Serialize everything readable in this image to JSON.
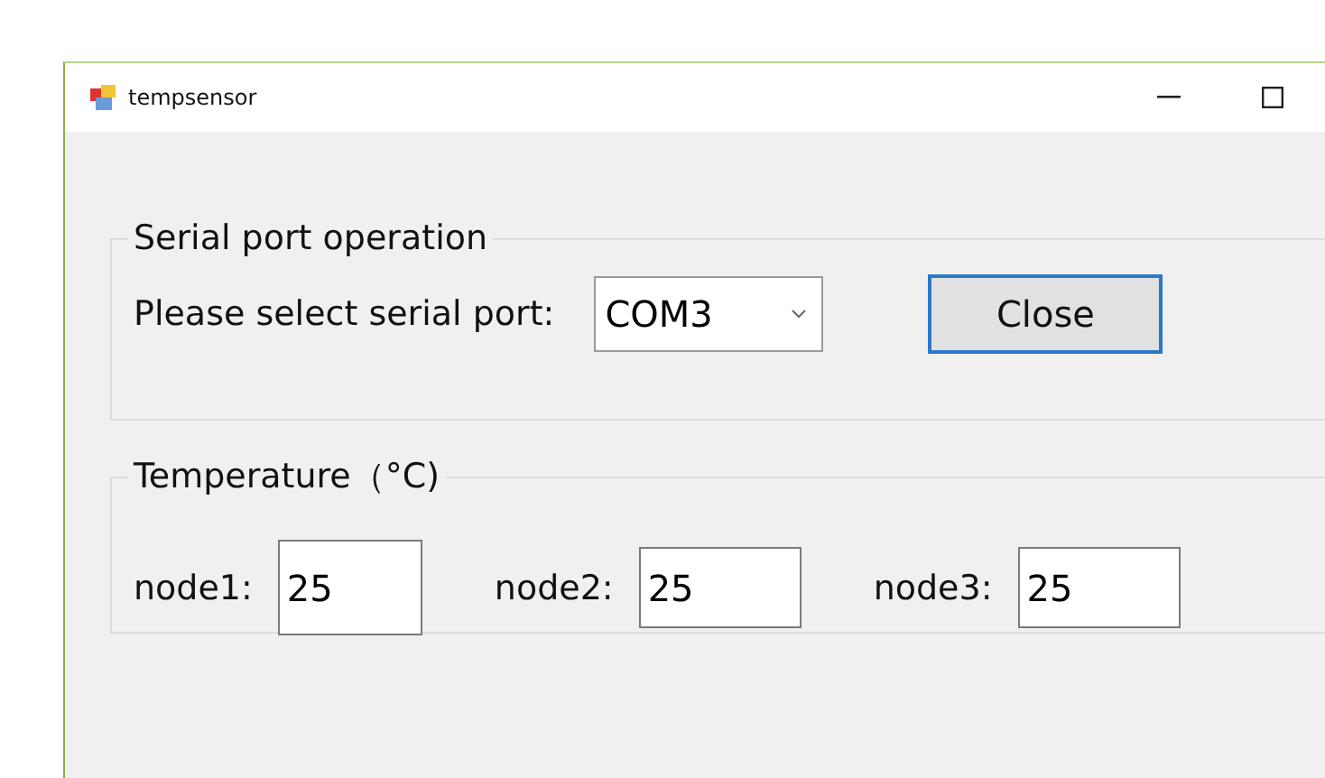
{
  "window": {
    "title": "tempsensor"
  },
  "serial_group": {
    "title": "Serial port operation",
    "label": "Please select serial port:",
    "port": "COM3",
    "button": "Close"
  },
  "temperature_group": {
    "title": "Temperature（°C)",
    "nodes": [
      {
        "label": "node1:",
        "value": "25"
      },
      {
        "label": "node2:",
        "value": "25"
      },
      {
        "label": "node3:",
        "value": "25"
      }
    ]
  }
}
